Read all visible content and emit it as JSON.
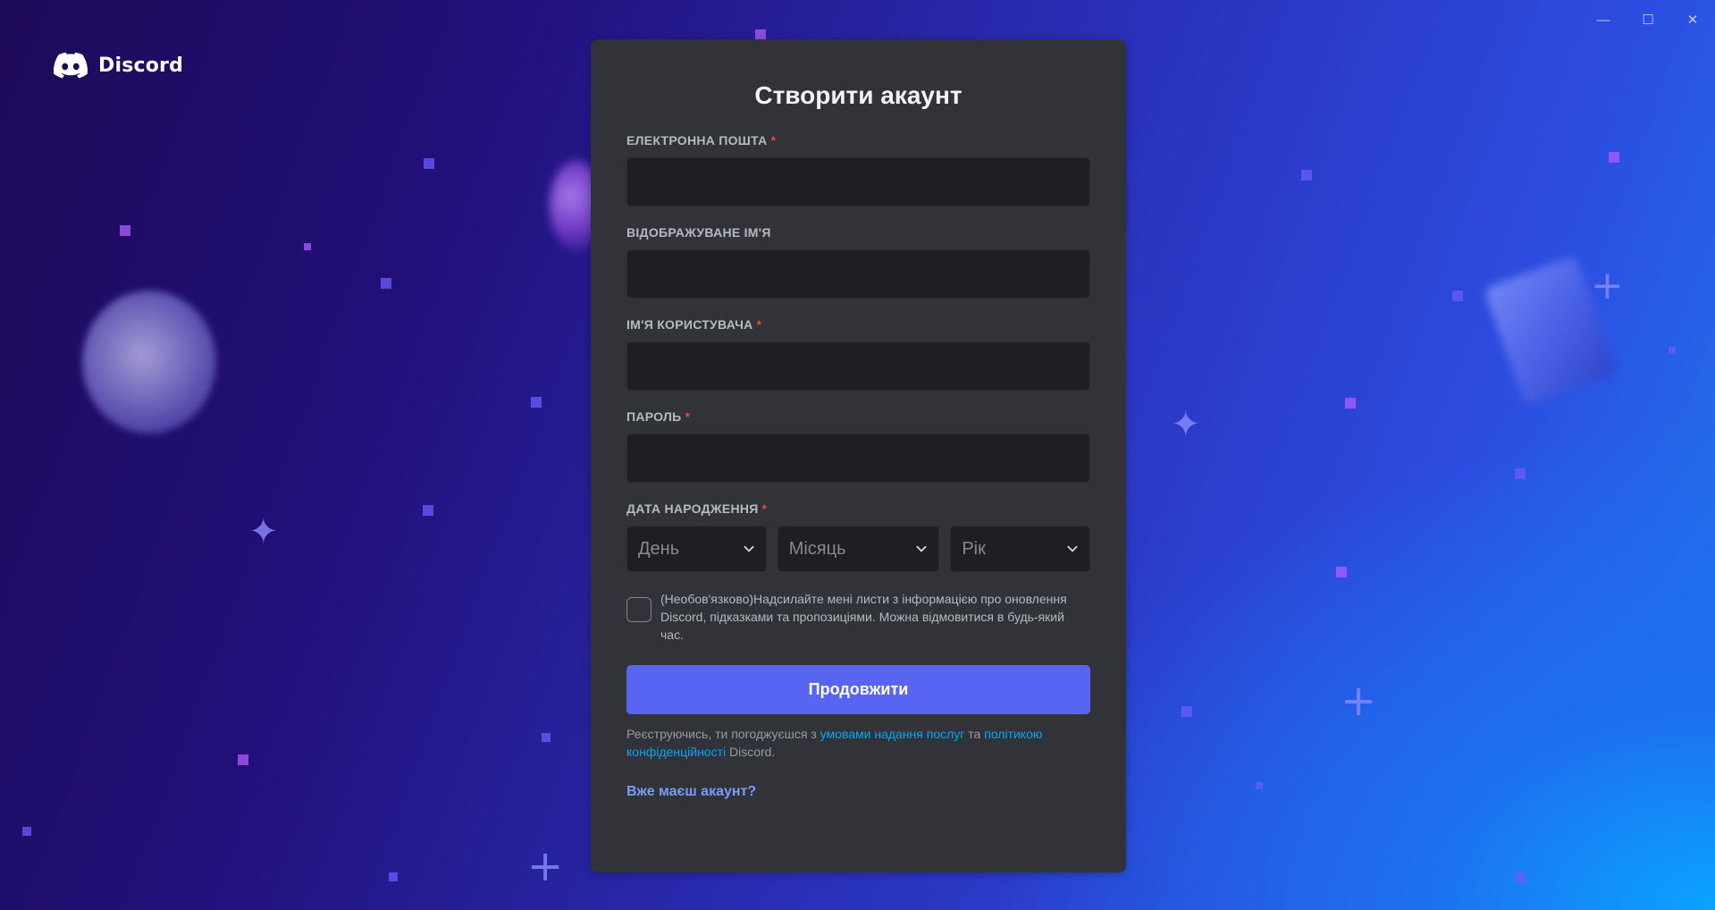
{
  "window": {
    "controls": [
      "minimize-icon",
      "maximize-icon",
      "close-icon"
    ],
    "minimize_glyph": "—",
    "maximize_glyph": "☐",
    "close_glyph": "✕"
  },
  "brand": {
    "name": "Discord",
    "icon": "discord-logo-icon"
  },
  "form": {
    "title": "Створити акаунт",
    "email": {
      "label": "ЕЛЕКТРОННА ПОШТА",
      "required": "*",
      "value": ""
    },
    "display_name": {
      "label": "ВІДОБРАЖУВАНЕ ІМ'Я",
      "value": ""
    },
    "username": {
      "label": "ІМ'Я КОРИСТУВАЧА",
      "required": "*",
      "value": ""
    },
    "password": {
      "label": "ПАРОЛЬ",
      "required": "*",
      "value": ""
    },
    "dob": {
      "label": "ДАТА НАРОДЖЕННЯ",
      "required": "*",
      "day_placeholder": "День",
      "month_placeholder": "Місяць",
      "year_placeholder": "Рік"
    },
    "optin_text": "(Необов'язково)Надсилайте мені листи з інформацією про оновлення Discord, підказками та пропозиціями. Можна відмовитися в будь-який час.",
    "continue_label": "Продовжити",
    "legal": {
      "prefix": "Реєструючись, ти погоджуєшся з ",
      "terms_link": "умовами надання послуг",
      "middle": " та ",
      "privacy_link": "політикою конфіденційності",
      "suffix": " Discord."
    },
    "login_link": "Вже маєш акаунт?"
  },
  "colors": {
    "accent": "#5865f2",
    "card_bg": "#313338",
    "input_bg": "#1e1f22",
    "required": "#f23f43",
    "link": "#00a8fc"
  }
}
